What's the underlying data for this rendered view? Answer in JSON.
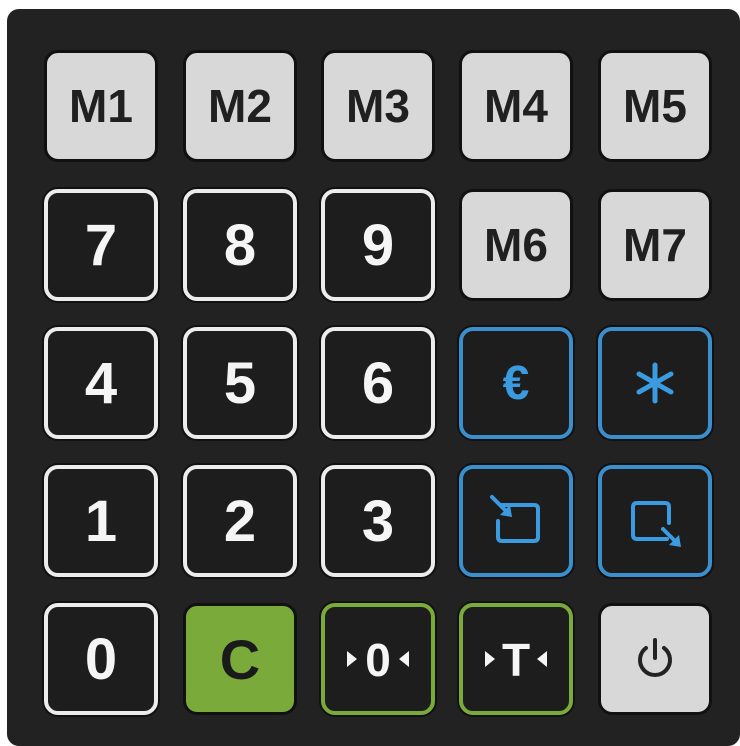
{
  "keys": {
    "m1": "M1",
    "m2": "M2",
    "m3": "M3",
    "m4": "M4",
    "m5": "M5",
    "m6": "M6",
    "m7": "M7",
    "n7": "7",
    "n8": "8",
    "n9": "9",
    "n4": "4",
    "n5": "5",
    "n6": "6",
    "n1": "1",
    "n2": "2",
    "n3": "3",
    "n0": "0",
    "clear": "C",
    "euro": "€"
  },
  "icons": {
    "asterisk": "asterisk-icon",
    "box_in": "box-arrow-in-icon",
    "box_out": "box-arrow-out-icon",
    "zero": "zero-set-icon",
    "tare": "tare-icon",
    "power": "power-icon"
  },
  "colors": {
    "panel": "#222222",
    "memory_key": "#d8d8d8",
    "number_border": "#ececec",
    "function_blue": "#3a8fcc",
    "green": "#7aaa3a"
  }
}
